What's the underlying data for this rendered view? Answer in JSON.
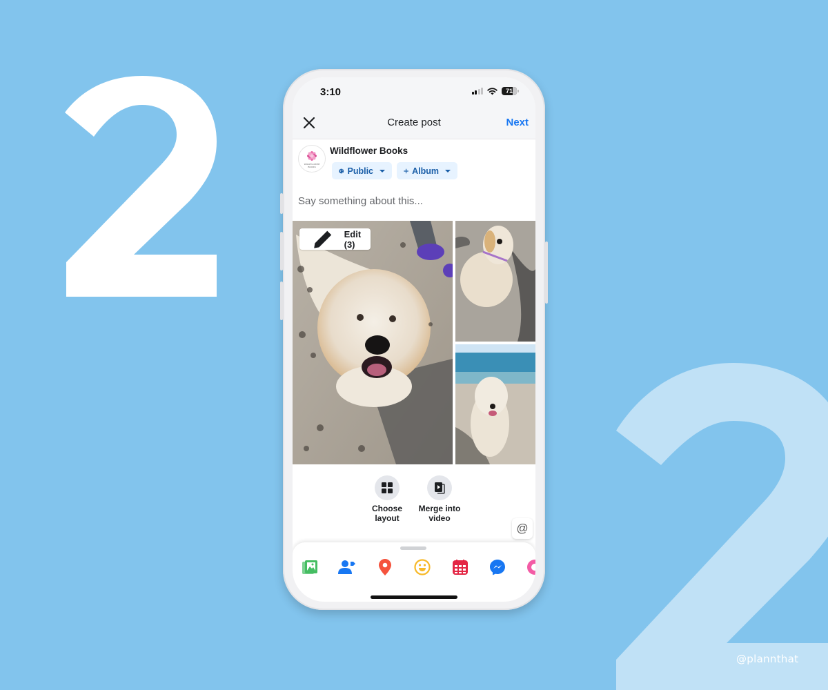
{
  "background": {
    "color": "#82c4ed",
    "left_numeral": "2",
    "right_numeral": "2",
    "left_numeral_color": "#ffffff",
    "right_numeral_color": "#c0e1f6",
    "watermark": "@plannthat"
  },
  "status_bar": {
    "time": "3:10",
    "battery_percent": "71",
    "signal_bars_active": 2,
    "signal_bars_total": 4,
    "wifi": true
  },
  "nav": {
    "close_icon": "close-icon",
    "title": "Create post",
    "next_label": "Next",
    "accent_color": "#1877f2"
  },
  "author": {
    "page_name": "Wildflower Books",
    "avatar_line1": "WILDFLOWER",
    "avatar_line2": "BOOKS",
    "audience_label": "Public",
    "audience_icon": "globe-icon",
    "album_label": "Album",
    "album_icon": "plus-icon"
  },
  "composer": {
    "placeholder": "Say something about this..."
  },
  "media": {
    "edit_label": "Edit (3)",
    "edit_icon": "pencil-icon",
    "photo_count": 3,
    "photos": [
      {
        "description": "Fluffy cream dog looking up on sandy beach"
      },
      {
        "description": "Dog sitting on sand with purple harness"
      },
      {
        "description": "Dog standing on beach with ocean behind"
      }
    ]
  },
  "actions": [
    {
      "label_line1": "Choose",
      "label_line2": "layout",
      "icon": "grid-layout-icon"
    },
    {
      "label_line1": "Merge into",
      "label_line2": "video",
      "icon": "merge-video-icon"
    }
  ],
  "mention": {
    "symbol": "@"
  },
  "toolbar": [
    {
      "icon": "photo-video-icon",
      "color": "#45bd62"
    },
    {
      "icon": "tag-people-icon",
      "color": "#1877f2"
    },
    {
      "icon": "location-icon",
      "color": "#f5533d"
    },
    {
      "icon": "feeling-icon",
      "color": "#f7b928"
    },
    {
      "icon": "event-icon",
      "color": "#e42645"
    },
    {
      "icon": "messenger-icon",
      "color": "#1877f2"
    },
    {
      "icon": "gif-icon",
      "color": "#f35ba5"
    }
  ]
}
